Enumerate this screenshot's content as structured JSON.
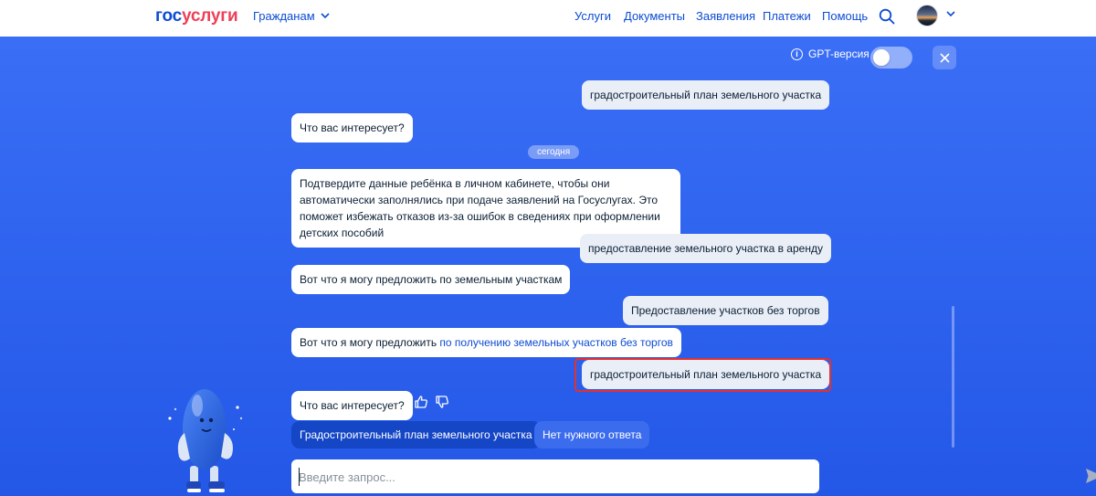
{
  "header": {
    "logo_part1": "гос",
    "logo_part2": "услуги",
    "citizens_label": "Гражданам",
    "nav": {
      "services": "Услуги",
      "documents": "Документы",
      "applications": "Заявления",
      "payments": "Платежи",
      "help": "Помощь"
    }
  },
  "chat": {
    "gpt_label": "GPT-версия",
    "gpt_enabled": false,
    "date_label": "сегодня",
    "messages": {
      "m1": "градостроительный план земельного участка",
      "m2": "Что вас интересует?",
      "m3": "Подтвердите данные ребёнка в личном кабинете, чтобы они автоматически заполнялись при подаче заявлений на Госуслугах. Это поможет избежать отказов из-за ошибок в сведениях при оформлении детских пособий",
      "m4": "предоставление земельного участка в аренду",
      "m5": "Вот что я могу предложить по земельным участкам",
      "m6": "Предоставление участков без торгов",
      "m7_prefix": "Вот что я могу предложить ",
      "m7_link": "по получению земельных участков без торгов",
      "m8": "градостроительный план земельного участка",
      "m9": "Что вас интересует?"
    },
    "quick_replies": {
      "option1": "Градостроительный план земельного участка",
      "option2": "Нет нужного ответа"
    },
    "input": {
      "placeholder": "Введите запрос...",
      "value": ""
    }
  },
  "colors": {
    "brand_blue": "#0d4cd3",
    "brand_red": "#ee3f58",
    "chat_bg": "#2d62ee",
    "highlight": "#e3312d"
  },
  "icons": [
    "chevron-down-icon",
    "search-icon",
    "avatar",
    "info-icon",
    "close-icon",
    "thumbs-up-icon",
    "thumbs-down-icon",
    "send-icon",
    "robot-mascot"
  ]
}
